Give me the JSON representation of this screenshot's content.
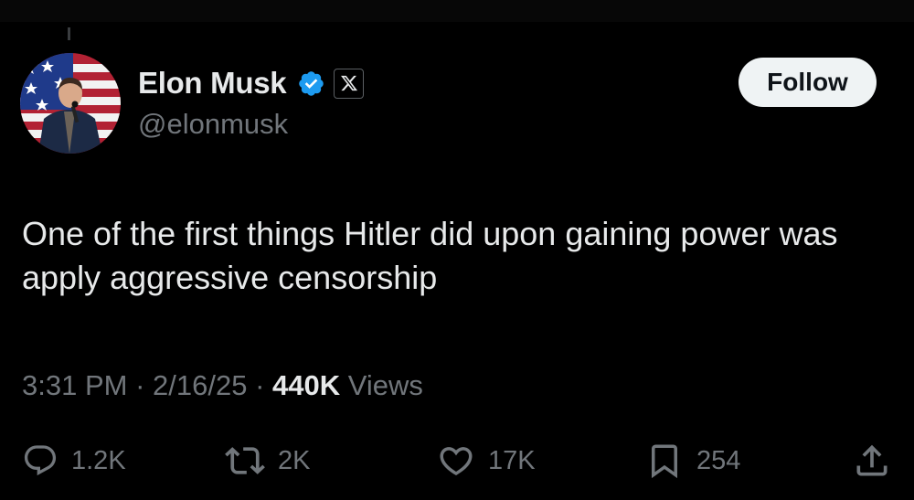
{
  "author": {
    "display_name": "Elon Musk",
    "handle": "@elonmusk",
    "verified_icon": "verified-badge-icon",
    "affiliate_icon": "x-logo-icon"
  },
  "follow_label": "Follow",
  "tweet": {
    "text": "One of the first things Hitler did upon gaining power was apply aggressive censorship"
  },
  "meta": {
    "time": "3:31 PM",
    "separator": " · ",
    "date": "2/16/25",
    "views_count": "440K",
    "views_label": " Views"
  },
  "actions": {
    "reply": {
      "icon": "reply-icon",
      "count": "1.2K"
    },
    "repost": {
      "icon": "repost-icon",
      "count": "2K"
    },
    "like": {
      "icon": "heart-icon",
      "count": "17K"
    },
    "bookmark": {
      "icon": "bookmark-icon",
      "count": "254"
    },
    "share": {
      "icon": "share-icon"
    }
  },
  "colors": {
    "background": "#000000",
    "primary_text": "#e7e9ea",
    "secondary_text": "#71767b",
    "verified_blue": "#1d9bf0",
    "follow_button_bg": "#eff3f4"
  }
}
